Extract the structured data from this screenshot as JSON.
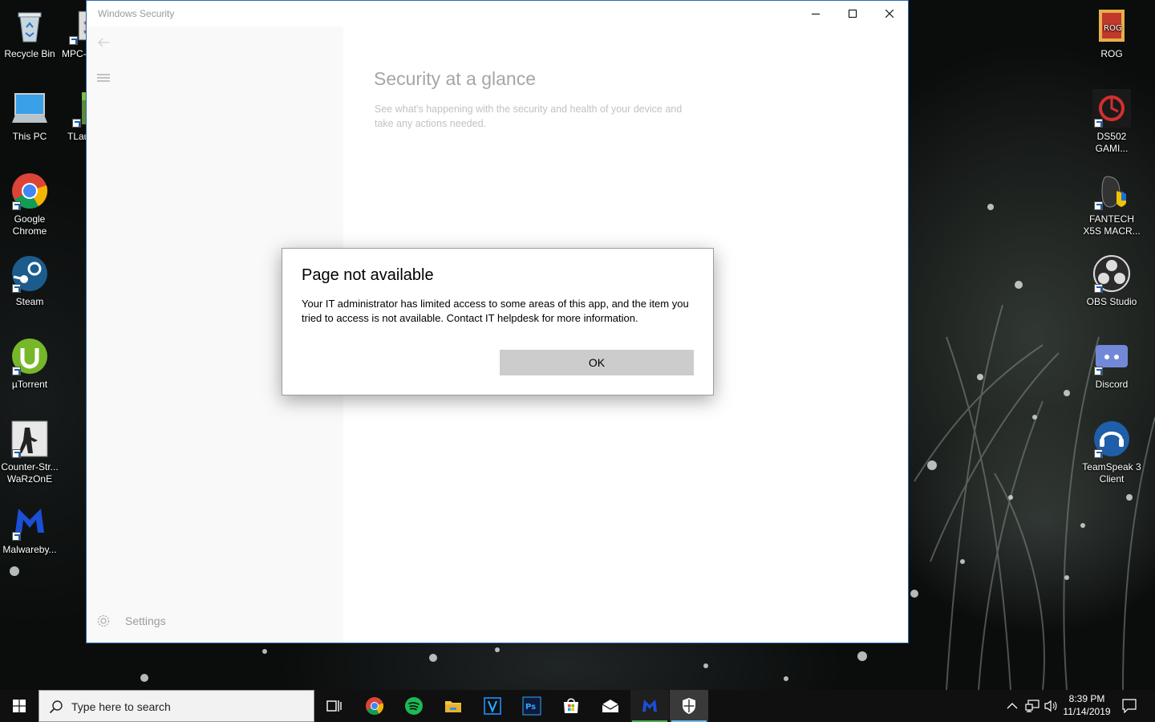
{
  "desktop": {
    "left_icons": [
      {
        "label": "Recycle Bin",
        "icon": "recycle-bin-icon"
      },
      {
        "label": "MPC-",
        "icon": "mpc-icon"
      },
      {
        "label": "This PC",
        "icon": "this-pc-icon"
      },
      {
        "label": "TLau",
        "icon": "tlauncher-icon"
      },
      {
        "label": "Google Chrome",
        "icon": "chrome-icon"
      },
      {
        "label": "Steam",
        "icon": "steam-icon"
      },
      {
        "label": "µTorrent",
        "icon": "utorrent-icon"
      },
      {
        "label": "Counter-Str... WaRzOnE",
        "icon": "counter-strike-icon"
      },
      {
        "label": "Malwareby...",
        "icon": "malwarebytes-icon"
      }
    ],
    "right_icons": [
      {
        "label": "ROG",
        "icon": "rog-folder-icon"
      },
      {
        "label": "DS502 GAMI...",
        "icon": "ds502-icon"
      },
      {
        "label": "FANTECH X5S MACR...",
        "icon": "fantech-icon"
      },
      {
        "label": "OBS Studio",
        "icon": "obs-icon"
      },
      {
        "label": "Discord",
        "icon": "discord-icon"
      },
      {
        "label": "TeamSpeak 3 Client",
        "icon": "teamspeak-icon"
      }
    ]
  },
  "window": {
    "title": "Windows Security",
    "sidebar": {
      "settings_label": "Settings"
    },
    "content": {
      "heading": "Security at a glance",
      "subtitle": "See what's happening with the security and health of your device and take any actions needed."
    }
  },
  "dialog": {
    "title": "Page not available",
    "message": "Your IT administrator has limited access to some areas of this app, and the item you tried to access is not available. Contact IT helpdesk for more information.",
    "ok_label": "OK"
  },
  "taskbar": {
    "search_placeholder": "Type here to search",
    "apps": [
      "task-view-icon",
      "chrome-icon",
      "spotify-icon",
      "file-explorer-icon",
      "v-app-icon",
      "photoshop-icon",
      "store-icon",
      "mail-icon",
      "malwarebytes-icon",
      "windows-security-icon"
    ],
    "clock": {
      "time": "8:39 PM",
      "date": "11/14/2019"
    }
  },
  "colors": {
    "accent": "#0078d7",
    "taskbar": "#101010",
    "dialog_button": "#cccccc"
  }
}
